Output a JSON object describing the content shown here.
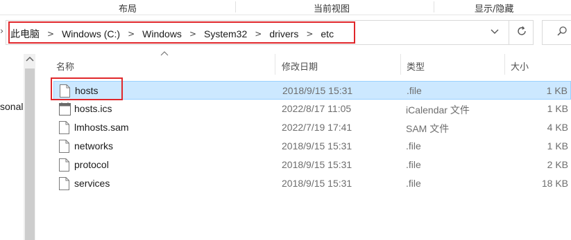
{
  "ribbon": {
    "groups": [
      "布局",
      "当前视图",
      "显示/隐藏"
    ]
  },
  "address_bar": {
    "crumbs": [
      "此电脑",
      "Windows (C:)",
      "Windows",
      "System32",
      "drivers",
      "etc"
    ],
    "dropdown_icon": "chevron-down-icon",
    "refresh_icon": "refresh-icon",
    "search_icon": "search-icon"
  },
  "nav_pane": {
    "visible_text": "sonal"
  },
  "file_list": {
    "columns": {
      "name": "名称",
      "date": "修改日期",
      "type": "类型",
      "size": "大小"
    },
    "rows": [
      {
        "name": "hosts",
        "date": "2018/9/15 15:31",
        "type": ".file",
        "size": "1 KB",
        "icon": "document-icon",
        "selected": true
      },
      {
        "name": "hosts.ics",
        "date": "2022/8/17 11:05",
        "type": "iCalendar 文件",
        "size": "1 KB",
        "icon": "calendar-file-icon",
        "selected": false
      },
      {
        "name": "lmhosts.sam",
        "date": "2022/7/19 17:41",
        "type": "SAM 文件",
        "size": "4 KB",
        "icon": "document-icon",
        "selected": false
      },
      {
        "name": "networks",
        "date": "2018/9/15 15:31",
        "type": ".file",
        "size": "1 KB",
        "icon": "document-icon",
        "selected": false
      },
      {
        "name": "protocol",
        "date": "2018/9/15 15:31",
        "type": ".file",
        "size": "2 KB",
        "icon": "document-icon",
        "selected": false
      },
      {
        "name": "services",
        "date": "2018/9/15 15:31",
        "type": ".file",
        "size": "18 KB",
        "icon": "document-icon",
        "selected": false
      }
    ]
  },
  "colors": {
    "selection_bg": "#cce8ff",
    "selection_border": "#99d1ff",
    "highlight_box": "#e0262a"
  }
}
